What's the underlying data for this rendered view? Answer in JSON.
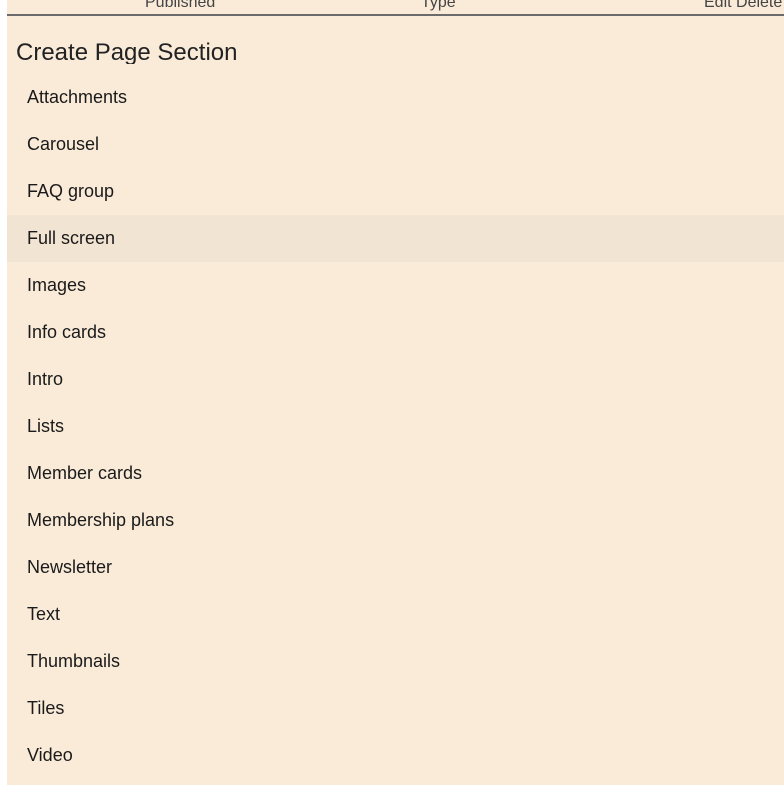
{
  "background_table": {
    "columns": [
      "Published",
      "Type",
      "Edit Delete"
    ]
  },
  "dialog": {
    "title": "Create Page Section",
    "hovered_item": "Full screen",
    "items": [
      "Attachments",
      "Carousel",
      "FAQ group",
      "Full screen",
      "Images",
      "Info cards",
      "Intro",
      "Lists",
      "Member cards",
      "Membership plans",
      "Newsletter",
      "Text",
      "Thumbnails",
      "Tiles",
      "Video"
    ]
  },
  "colors": {
    "dialog_background": "#faebd9",
    "hover_row": "#f2e4d2",
    "header_rule": "#6b6b6b"
  }
}
